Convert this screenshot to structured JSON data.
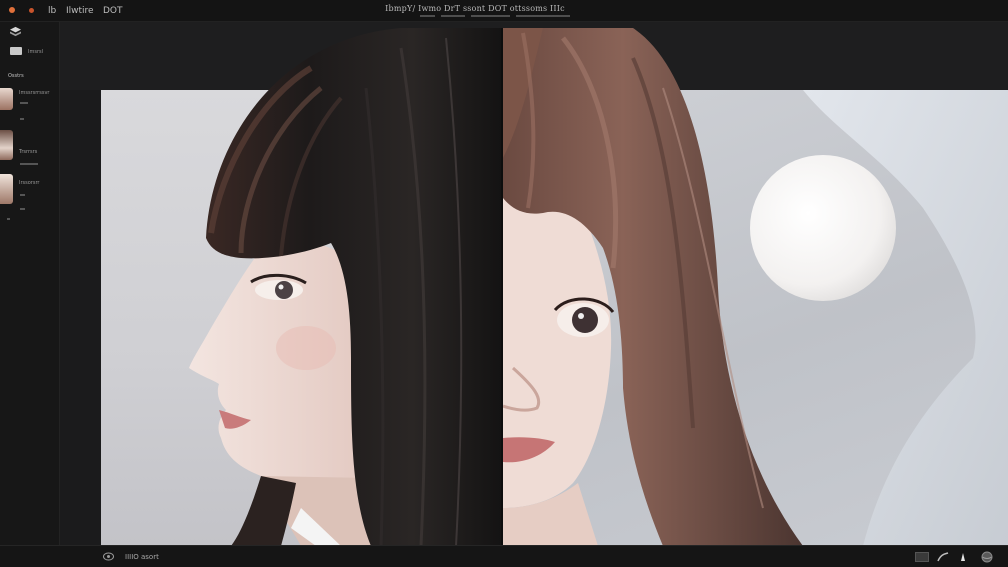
{
  "titlebar": {
    "menu_1": "lb",
    "menu_2": "Ilwtire",
    "menu_3": "DOT",
    "title": "IbmpY/ Iwmo DrT ssont DOT ottssoms IIIc",
    "accent_color": "#e0703a"
  },
  "sidebar": {
    "items": [
      {
        "icon": "layer-stack-icon"
      },
      {
        "label": "Imsrsl"
      },
      {
        "label": "Osstrs"
      },
      {
        "label": "Imssrsrrssvr"
      },
      {
        "label": "Trsrrsrs"
      },
      {
        "label": "Irssorsrr"
      }
    ]
  },
  "toolbar": {
    "tools": [
      "rectangle-select-icon",
      "diamond-shape-icon"
    ]
  },
  "canvas": {
    "left_panel": "portrait-profile-dark-hair",
    "right_panel": "portrait-front-brown-hair"
  },
  "statusbar": {
    "text": "IIIIO asort",
    "icons": [
      "eye-icon",
      "rectangle-icon",
      "curve-tool-icon",
      "pen-icon",
      "sphere-icon"
    ]
  }
}
